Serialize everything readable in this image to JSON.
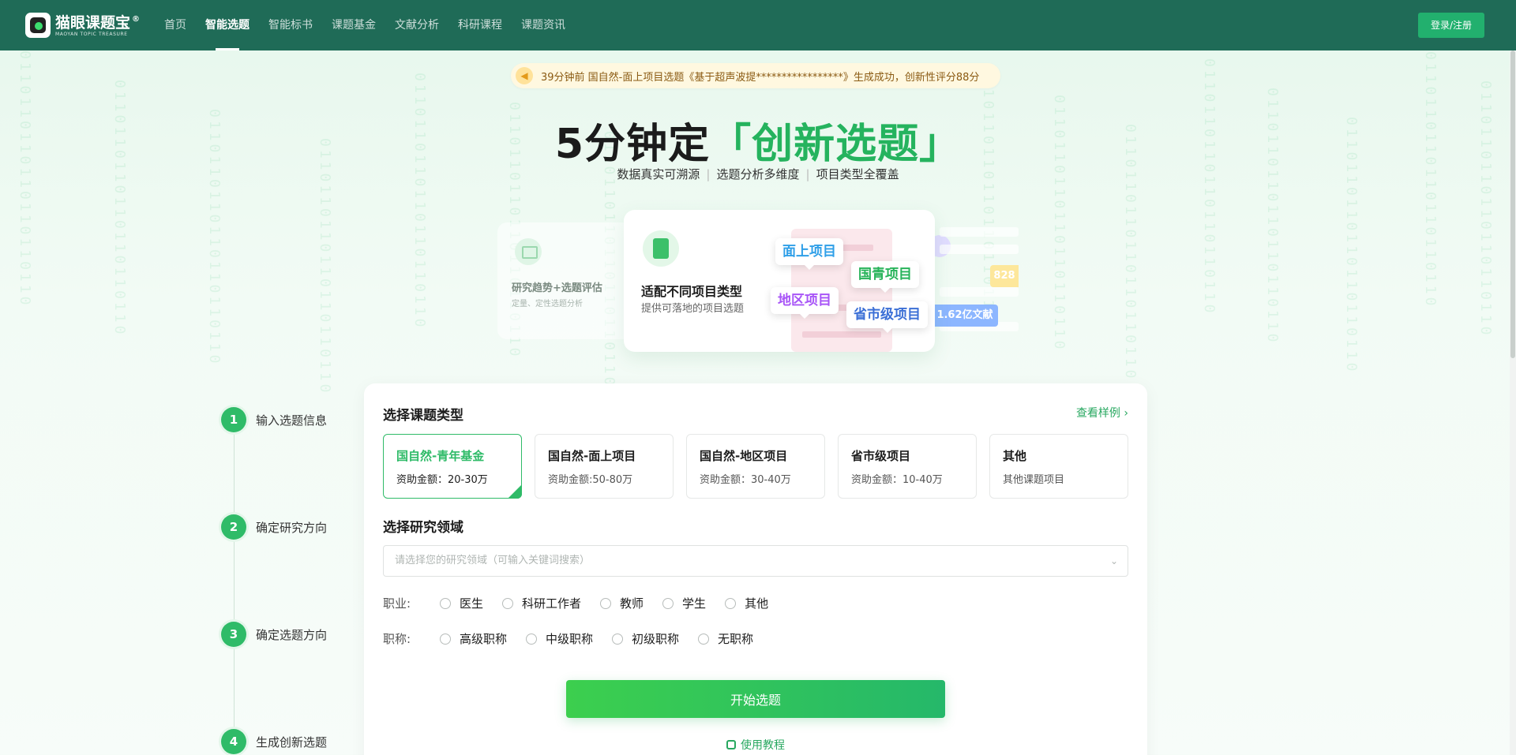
{
  "nav": {
    "logo_cn": "猫眼课题宝",
    "logo_reg": "®",
    "logo_en": "MAOYAN TOPIC TREASURE",
    "menu": [
      {
        "label": "首页"
      },
      {
        "label": "智能选题"
      },
      {
        "label": "智能标书"
      },
      {
        "label": "课题基金"
      },
      {
        "label": "文献分析"
      },
      {
        "label": "科研课程"
      },
      {
        "label": "课题资讯"
      }
    ],
    "active_index": 1,
    "login_label": "登录/注册"
  },
  "notice": {
    "text": "39分钟前  国自然-面上项目选题《基于超声波提*****************》生成成功，创新性评分88分"
  },
  "hero": {
    "title_prefix": "5分钟定",
    "title_highlight": "「创新选题」",
    "subtitle": [
      "数据真实可溯源",
      "选题分析多维度",
      "项目类型全覆盖"
    ],
    "subtitle_sep": "|"
  },
  "features": {
    "back_title": "研究趋势+选题评估",
    "back_desc": "定量、定性选题分析",
    "main_title": "适配不同项目类型",
    "main_desc": "提供可落地的项目选题",
    "chips": [
      "面上项目",
      "国青项目",
      "地区项目",
      "省市级项目"
    ],
    "chip_colors": [
      "#2f9fe8",
      "#27b35a",
      "#a855f7",
      "#3b6fd6"
    ],
    "stat_1": "828",
    "stat_2": "1.62亿文献"
  },
  "steps": [
    {
      "num": "1",
      "label": "输入选题信息"
    },
    {
      "num": "2",
      "label": "确定研究方向"
    },
    {
      "num": "3",
      "label": "确定选题方向"
    },
    {
      "num": "4",
      "label": "生成创新选题"
    }
  ],
  "form": {
    "type_title": "选择课题类型",
    "sample_link": "查看样例 ›",
    "types": [
      {
        "name": "国自然-青年基金",
        "amount": "资助金额：20-30万"
      },
      {
        "name": "国自然-面上项目",
        "amount": "资助金额:50-80万"
      },
      {
        "name": "国自然-地区项目",
        "amount": "资助金额：30-40万"
      },
      {
        "name": "省市级项目",
        "amount": "资助金额：10-40万"
      },
      {
        "name": "其他",
        "amount": "其他课题项目"
      }
    ],
    "selected_type": 0,
    "field_title": "选择研究领域",
    "field_placeholder": "请选择您的研究领域（可输入关键词搜索）",
    "job_label": "职业:",
    "jobs": [
      "医生",
      "科研工作者",
      "教师",
      "学生",
      "其他"
    ],
    "rank_label": "职称:",
    "ranks": [
      "高级职称",
      "中级职称",
      "初级职称",
      "无职称"
    ],
    "start_label": "开始选题",
    "tutorial_label": "使用教程"
  },
  "colors": {
    "nav_bg": "#1f6b57",
    "accent": "#2fbb68",
    "login_bg": "#22b06e"
  }
}
